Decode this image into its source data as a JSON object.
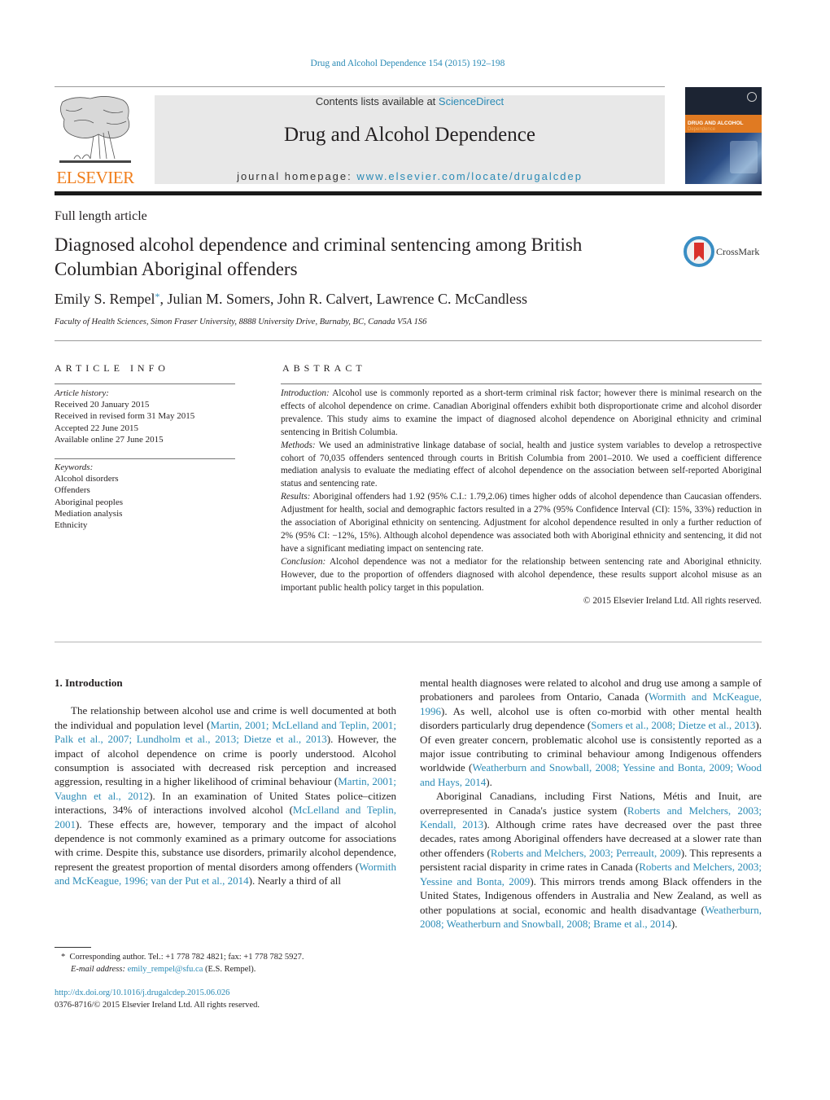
{
  "header": {
    "citation": "Drug and Alcohol Dependence 154 (2015) 192–198",
    "publisher_logo_text": "ELSEVIER",
    "contents_prefix": "Contents lists available at ",
    "contents_link": "ScienceDirect",
    "journal_name": "Drug and Alcohol Dependence",
    "homepage_prefix": "journal homepage: ",
    "homepage_link": "www.elsevier.com/locate/drugalcdep",
    "cover_title": "DRUG AND ALCOHOL",
    "cover_subtitle": "Dependence"
  },
  "article": {
    "type": "Full length article",
    "title": "Diagnosed alcohol dependence and criminal sentencing among British Columbian Aboriginal offenders",
    "crossmark_label": "CrossMark",
    "authors": [
      {
        "name": "Emily S. Rempel",
        "mark": "*"
      },
      {
        "name": "Julian M. Somers"
      },
      {
        "name": "John R. Calvert"
      },
      {
        "name": "Lawrence C. McCandless"
      }
    ],
    "affiliation": "Faculty of Health Sciences, Simon Fraser University, 8888 University Drive, Burnaby, BC, Canada V5A 1S6"
  },
  "article_info": {
    "heading": "ARTICLE INFO",
    "history_label": "Article history:",
    "history": [
      "Received 20 January 2015",
      "Received in revised form 31 May 2015",
      "Accepted 22 June 2015",
      "Available online 27 June 2015"
    ],
    "keywords_label": "Keywords:",
    "keywords": [
      "Alcohol disorders",
      "Offenders",
      "Aboriginal peoples",
      "Mediation analysis",
      "Ethnicity"
    ]
  },
  "abstract": {
    "heading": "ABSTRACT",
    "sections": [
      {
        "label": "Introduction:",
        "text": " Alcohol use is commonly reported as a short-term criminal risk factor; however there is minimal research on the effects of alcohol dependence on crime. Canadian Aboriginal offenders exhibit both disproportionate crime and alcohol disorder prevalence. This study aims to examine the impact of diagnosed alcohol dependence on Aboriginal ethnicity and criminal sentencing in British Columbia."
      },
      {
        "label": "Methods:",
        "text": " We used an administrative linkage database of social, health and justice system variables to develop a retrospective cohort of 70,035 offenders sentenced through courts in British Columbia from 2001–2010. We used a coefficient difference mediation analysis to evaluate the mediating effect of alcohol dependence on the association between self-reported Aboriginal status and sentencing rate."
      },
      {
        "label": "Results:",
        "text": " Aboriginal offenders had 1.92 (95% C.I.: 1.79,2.06) times higher odds of alcohol dependence than Caucasian offenders. Adjustment for health, social and demographic factors resulted in a 27% (95% Confidence Interval (CI): 15%, 33%) reduction in the association of Aboriginal ethnicity on sentencing. Adjustment for alcohol dependence resulted in only a further reduction of 2% (95% CI: −12%, 15%). Although alcohol dependence was associated both with Aboriginal ethnicity and sentencing, it did not have a significant mediating impact on sentencing rate."
      },
      {
        "label": "Conclusion:",
        "text": " Alcohol dependence was not a mediator for the relationship between sentencing rate and Aboriginal ethnicity. However, due to the proportion of offenders diagnosed with alcohol dependence, these results support alcohol misuse as an important public health policy target in this population."
      }
    ],
    "copyright": "© 2015 Elsevier Ireland Ltd. All rights reserved."
  },
  "body": {
    "intro_heading": "1.  Introduction",
    "p1": [
      {
        "t": "The relationship between alcohol use and crime is well documented at both the individual and population level ("
      },
      {
        "l": "Martin, 2001; McLelland and Teplin, 2001; Palk et al., 2007; Lundholm et al., 2013; Dietze et al., 2013"
      },
      {
        "t": "). However, the impact of alcohol dependence on crime is poorly understood. Alcohol consumption is associated with decreased risk perception and increased aggression, resulting in a higher likelihood of criminal behaviour ("
      },
      {
        "l": "Martin, 2001; Vaughn et al., 2012"
      },
      {
        "t": "). In an examination of United States police–citizen interactions, 34% of interactions involved alcohol ("
      },
      {
        "l": "McLelland and Teplin, 2001"
      },
      {
        "t": "). These effects are, however, temporary and the impact of alcohol dependence is not commonly examined as a primary outcome for associations with crime. Despite this, substance use disorders, primarily alcohol dependence, represent the greatest proportion of mental disorders among offenders ("
      },
      {
        "l": "Wormith and McKeague, 1996; van der Put et al., 2014"
      },
      {
        "t": "). Nearly a third of all mental health diagnoses were related to alcohol and drug use among a sample of probationers and parolees from Ontario, Canada ("
      },
      {
        "l": "Wormith and McKeague, 1996"
      },
      {
        "t": "). As well, alcohol use is often co-morbid with other mental health disorders particularly drug dependence ("
      },
      {
        "l": "Somers et al., 2008; Dietze et al., 2013"
      },
      {
        "t": "). Of even greater concern, problematic alcohol use is consistently reported as a major issue contributing to criminal behaviour among Indigenous offenders worldwide ("
      },
      {
        "l": "Weatherburn and Snowball, 2008; Yessine and Bonta, 2009; Wood and Hays, 2014"
      },
      {
        "t": ")."
      }
    ],
    "p2": [
      {
        "t": "Aboriginal Canadians, including First Nations, Métis and Inuit, are overrepresented in Canada's justice system ("
      },
      {
        "l": "Roberts and Melchers, 2003; Kendall, 2013"
      },
      {
        "t": "). Although crime rates have decreased over the past three decades, rates among Aboriginal offenders have decreased at a slower rate than other offenders ("
      },
      {
        "l": "Roberts and Melchers, 2003; Perreault, 2009"
      },
      {
        "t": "). This represents a persistent racial disparity in crime rates in Canada ("
      },
      {
        "l": "Roberts and Melchers, 2003; Yessine and Bonta, 2009"
      },
      {
        "t": "). This mirrors trends among Black offenders in the United States, Indigenous offenders in Australia and New Zealand, as well as other populations at social, economic and health disadvantage ("
      },
      {
        "l": "Weatherburn, 2008; Weatherburn and Snowball, 2008; Brame et al., 2014"
      },
      {
        "t": ")."
      }
    ]
  },
  "footnotes": {
    "star": "*",
    "corresponding": "Corresponding author. Tel.: +1 778 782 4821; fax: +1 778 782 5927.",
    "email_label": "E-mail address:",
    "email": "emily_rempel@sfu.ca",
    "email_suffix": " (E.S. Rempel).",
    "doi": "http://dx.doi.org/10.1016/j.drugalcdep.2015.06.026",
    "issn_line": "0376-8716/© 2015 Elsevier Ireland Ltd. All rights reserved."
  }
}
